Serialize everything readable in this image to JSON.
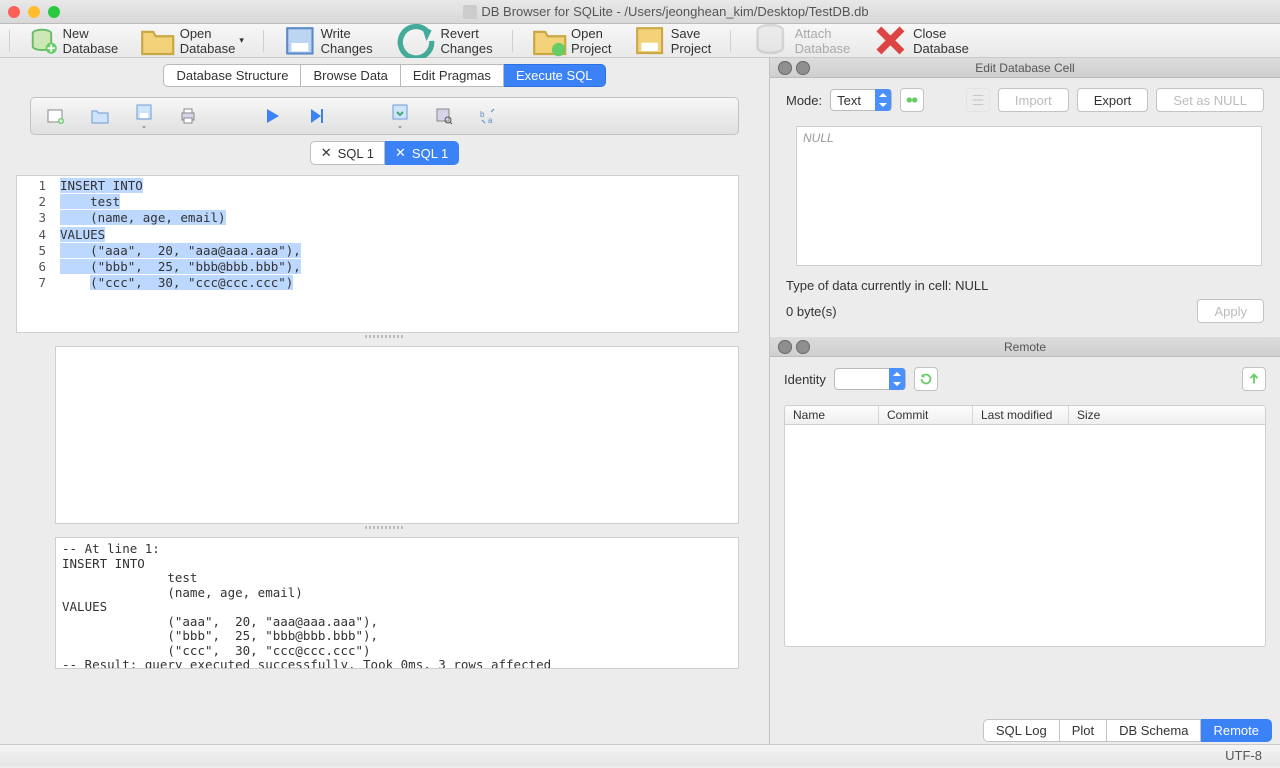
{
  "window": {
    "title": "DB Browser for SQLite - /Users/jeonghean_kim/Desktop/TestDB.db"
  },
  "toolbar": {
    "newdb": "New Database",
    "opendb": "Open Database",
    "write": "Write Changes",
    "revert": "Revert Changes",
    "openproj": "Open Project",
    "saveproj": "Save Project",
    "attach": "Attach Database",
    "close": "Close Database"
  },
  "tabs": {
    "structure": "Database Structure",
    "browse": "Browse Data",
    "pragmas": "Edit Pragmas",
    "execsql": "Execute SQL"
  },
  "sqltabs": {
    "t1": "SQL 1",
    "t2": "SQL 1"
  },
  "editor": {
    "lines": [
      "1",
      "2",
      "3",
      "4",
      "5",
      "6",
      "7"
    ],
    "code": [
      "INSERT INTO",
      "    test",
      "    (name, age, email)",
      "VALUES",
      "    (\"aaa\",  20, \"aaa@aaa.aaa\"),",
      "    (\"bbb\",  25, \"bbb@bbb.bbb\"),",
      "    (\"ccc\",  30, \"ccc@ccc.ccc\")"
    ]
  },
  "result": "-- At line 1:\nINSERT INTO\n              test\n              (name, age, email)\nVALUES\n              (\"aaa\",  20, \"aaa@aaa.aaa\"),\n              (\"bbb\",  25, \"bbb@bbb.bbb\"),\n              (\"ccc\",  30, \"ccc@ccc.ccc\")\n-- Result: query executed successfully. Took 0ms, 3 rows affected",
  "cell": {
    "panetitle": "Edit Database Cell",
    "modelabel": "Mode:",
    "modevalue": "Text",
    "import": "Import",
    "export": "Export",
    "setnull": "Set as NULL",
    "placeholder": "NULL",
    "typeinfo": "Type of data currently in cell: NULL",
    "sizeinfo": "0 byte(s)",
    "apply": "Apply"
  },
  "remote": {
    "panetitle": "Remote",
    "identity": "Identity",
    "cols": {
      "name": "Name",
      "commit": "Commit",
      "lastmod": "Last modified",
      "size": "Size"
    }
  },
  "footer": {
    "sqllog": "SQL Log",
    "plot": "Plot",
    "schema": "DB Schema",
    "remote": "Remote"
  },
  "status": {
    "encoding": "UTF-8"
  }
}
